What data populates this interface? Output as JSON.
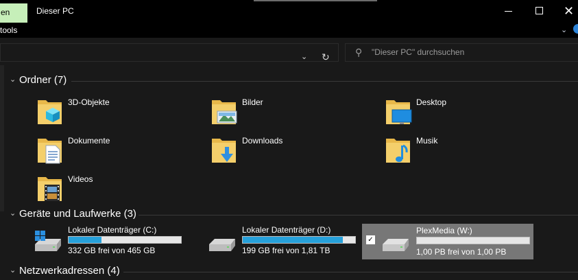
{
  "window": {
    "ribbon_tab_partial": "en",
    "title": "Dieser PC",
    "tools_tab_partial": "tools",
    "minimize": "—",
    "close": "✕",
    "ribbon_toggle": "⌄"
  },
  "address": {
    "search_placeholder": "\"Dieser PC\" durchsuchen"
  },
  "groups": {
    "folders": {
      "title": "Ordner (7)",
      "items": [
        {
          "label": "3D-Objekte",
          "icon": "3d-objects-folder-icon"
        },
        {
          "label": "Bilder",
          "icon": "pictures-folder-icon"
        },
        {
          "label": "Desktop",
          "icon": "desktop-folder-icon"
        },
        {
          "label": "Dokumente",
          "icon": "documents-folder-icon"
        },
        {
          "label": "Downloads",
          "icon": "downloads-folder-icon"
        },
        {
          "label": "Musik",
          "icon": "music-folder-icon"
        },
        {
          "label": "Videos",
          "icon": "videos-folder-icon"
        }
      ]
    },
    "drives": {
      "title": "Geräte und Laufwerke (3)",
      "items": [
        {
          "name": "Lokaler Datenträger (C:)",
          "free_text": "332 GB frei von 465 GB",
          "used_fraction": 0.29,
          "icon": "windows-drive-icon"
        },
        {
          "name": "Lokaler Datenträger (D:)",
          "free_text": "199 GB frei von 1,81 TB",
          "used_fraction": 0.89,
          "icon": "hard-drive-icon"
        },
        {
          "name": "PlexMedia (W:)",
          "free_text": "1,00 PB frei von 1,00 PB",
          "used_fraction": 0.0,
          "icon": "network-drive-icon",
          "selected": true
        }
      ]
    },
    "network": {
      "title": "Netzwerkadressen (4)"
    }
  },
  "colors": {
    "accent": "#26a0da",
    "selection": "#777777",
    "ribbon_tab": "#c6efb9"
  }
}
